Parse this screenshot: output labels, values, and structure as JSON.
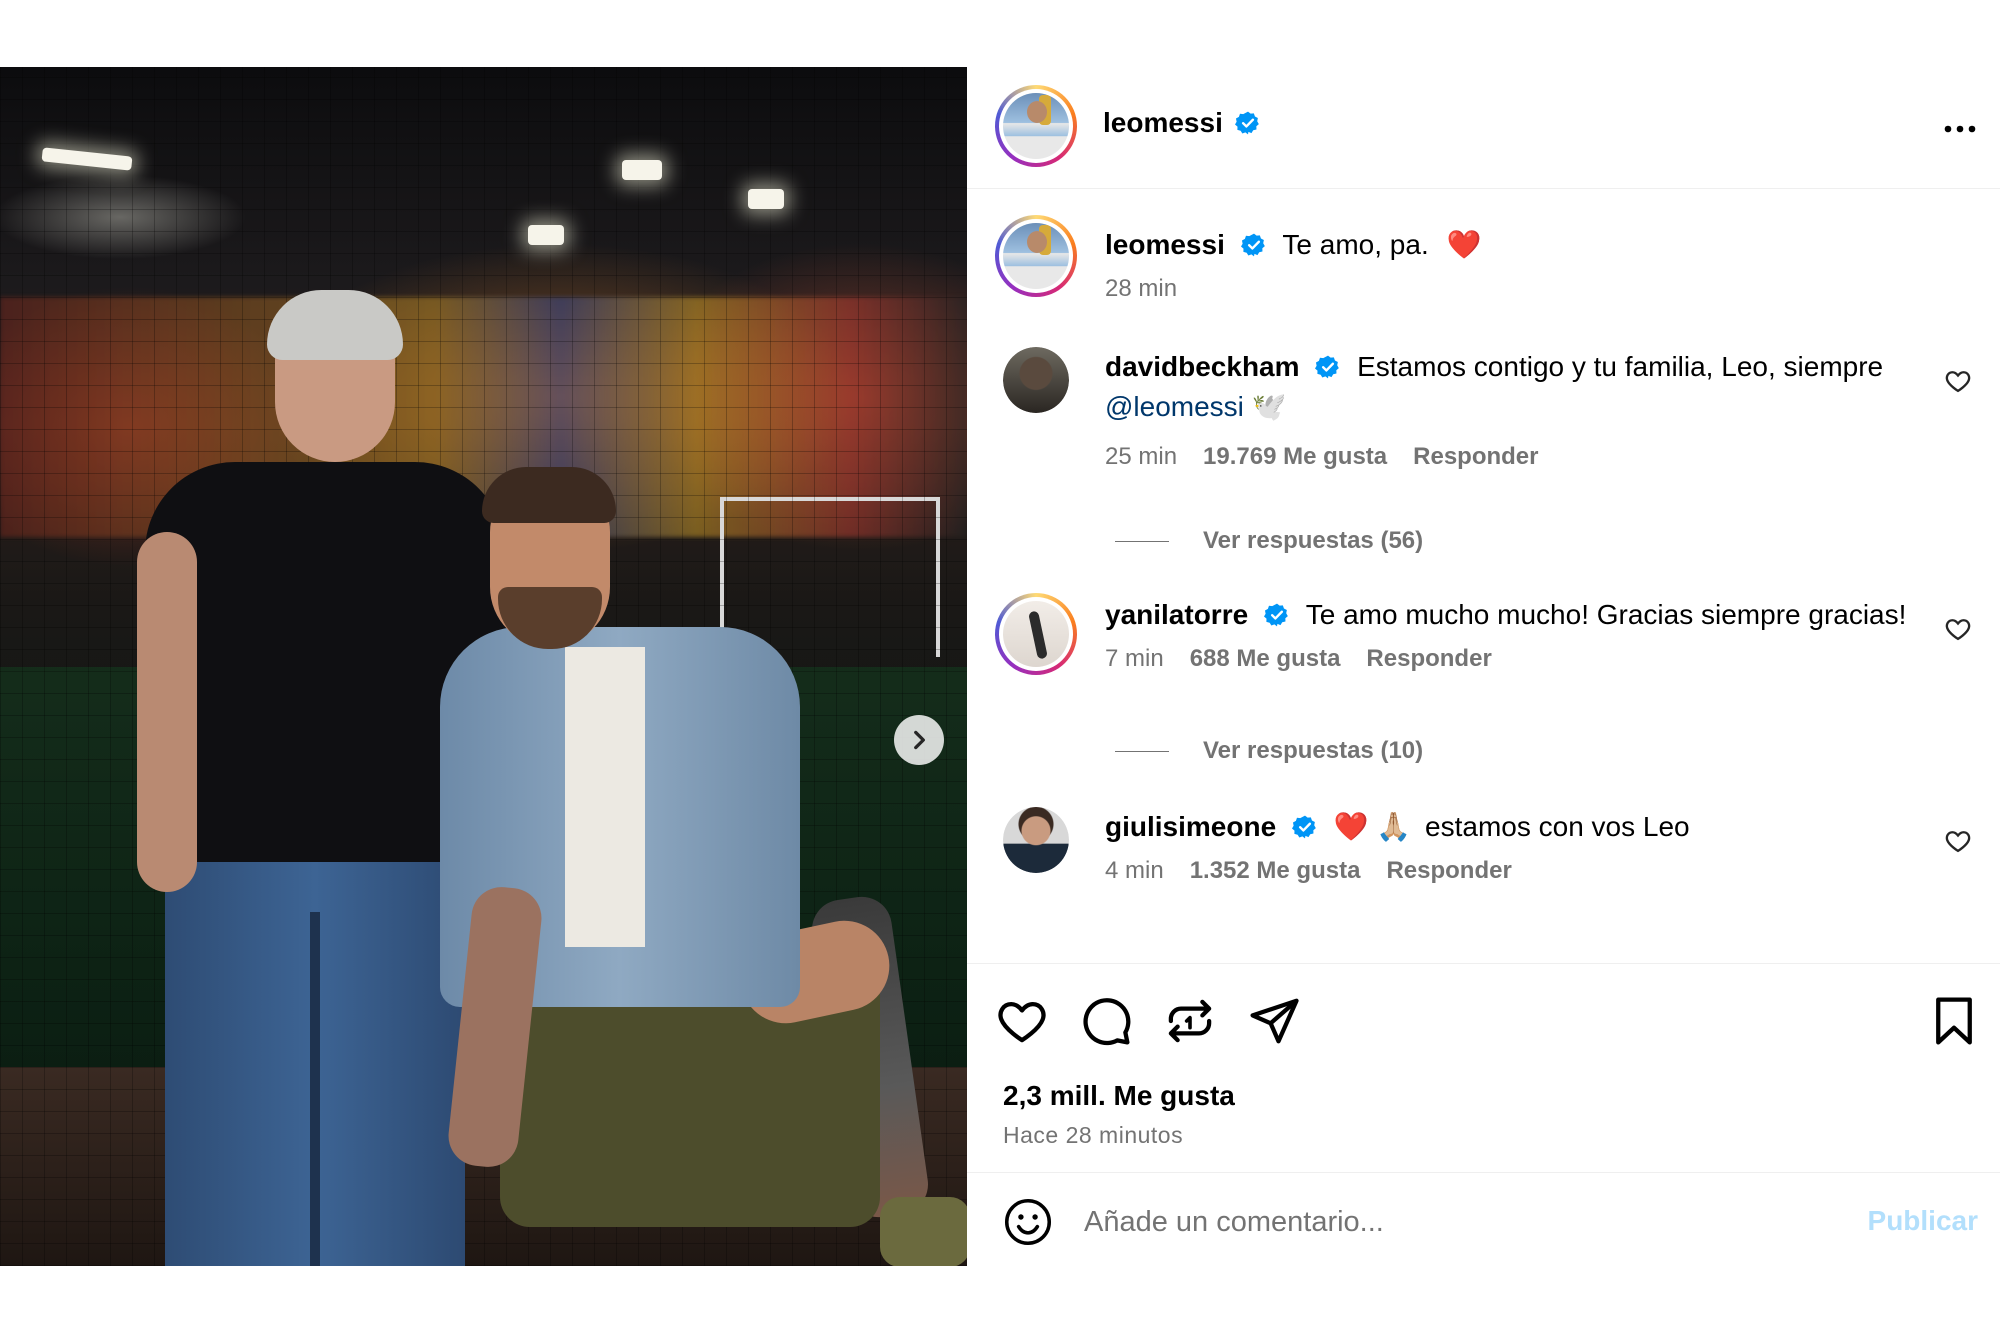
{
  "post": {
    "author": "leomessi",
    "verified": true,
    "media_dots": 3,
    "active_dot": 0
  },
  "caption": {
    "author": "leomessi",
    "text": "Te amo, pa.",
    "emoji": "❤️",
    "time": "28 min"
  },
  "comments": [
    {
      "author": "davidbeckham",
      "text": "Estamos contigo y tu familia, Leo, siempre",
      "mention": "@leomessi",
      "emoji": "🕊️",
      "time": "25 min",
      "likes": "19.769 Me gusta",
      "reply_label": "Responder",
      "view_replies": "Ver respuestas (56)"
    },
    {
      "author": "yanilatorre",
      "text": "Te amo mucho mucho! Gracias siempre gracias!",
      "time": "7 min",
      "likes": "688 Me gusta",
      "reply_label": "Responder",
      "view_replies": "Ver respuestas (10)"
    },
    {
      "author": "giulisimeone",
      "emoji": "❤️ 🙏🏼",
      "text": "estamos con vos Leo",
      "time": "4 min",
      "likes": "1.352 Me gusta",
      "reply_label": "Responder"
    }
  ],
  "stats": {
    "likes": "2,3 mill. Me gusta",
    "posted": "Hace 28 minutos"
  },
  "composer": {
    "placeholder": "Añade un comentario...",
    "publish_label": "Publicar"
  },
  "colors": {
    "verified": "#0095f6",
    "muted": "#737373",
    "publish_disabled": "#b2dffc",
    "mention": "#00376b",
    "heart": "#ff3040"
  }
}
